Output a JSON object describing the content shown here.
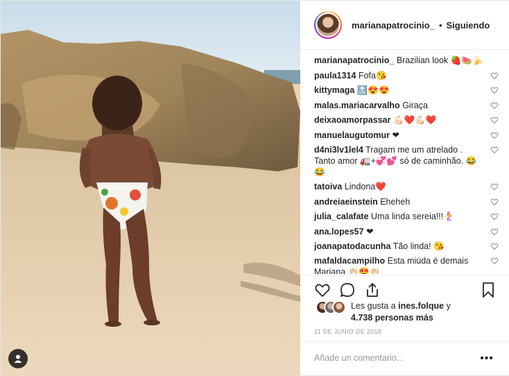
{
  "header": {
    "username": "marianapatrocinio_",
    "separator": "•",
    "follow_status": "Siguiendo"
  },
  "caption": {
    "username": "marianapatrocinio_",
    "text": "Brazilian look 🍓🍉🍌"
  },
  "comments": [
    {
      "user": "paula1314",
      "text": "Fofa😘"
    },
    {
      "user": "kittymaga",
      "text": "🔝😍😍"
    },
    {
      "user": "malas.mariacarvalho",
      "text": "Giraça"
    },
    {
      "user": "deixaoamorpassar",
      "text": "💪🏻❤️💪🏻❤️"
    },
    {
      "user": "manuelaugutomur",
      "text": "❤"
    },
    {
      "user": "d4ni3lv1lel4",
      "text": "Tragam me um atrelado . Tanto amor 🚛+💞💕 só de caminhão. 😂😂"
    },
    {
      "user": "tatoiva",
      "text": "Lindona❤️"
    },
    {
      "user": "andreiaeinstein",
      "text": "Eheheh"
    },
    {
      "user": "julia_calafate",
      "text": "Uma linda sereia!!!🧜‍♀️"
    },
    {
      "user": "ana.lopes57",
      "text": "❤"
    },
    {
      "user": "joanapatodacunha",
      "text": "Tão linda! 😘"
    },
    {
      "user": "mafaldacampilho",
      "text": "Esta miúda é demais Mariana 👏🏻😍👏🏻"
    }
  ],
  "likes": {
    "prefix": "Les gusta a",
    "user": "ines.folque",
    "connector": "y",
    "count_text": "4.738 personas más"
  },
  "date": "11 DE JUNIO DE 2018",
  "comment_input": {
    "placeholder": "Añade un comentario...",
    "more_label": "•••"
  },
  "icons": {
    "like": "heart-icon",
    "comment": "comment-icon",
    "share": "share-icon",
    "save": "bookmark-icon",
    "user_tag": "user-tag-icon"
  },
  "colors": {
    "text": "#262626",
    "muted": "#999999",
    "border": "#efefef"
  }
}
